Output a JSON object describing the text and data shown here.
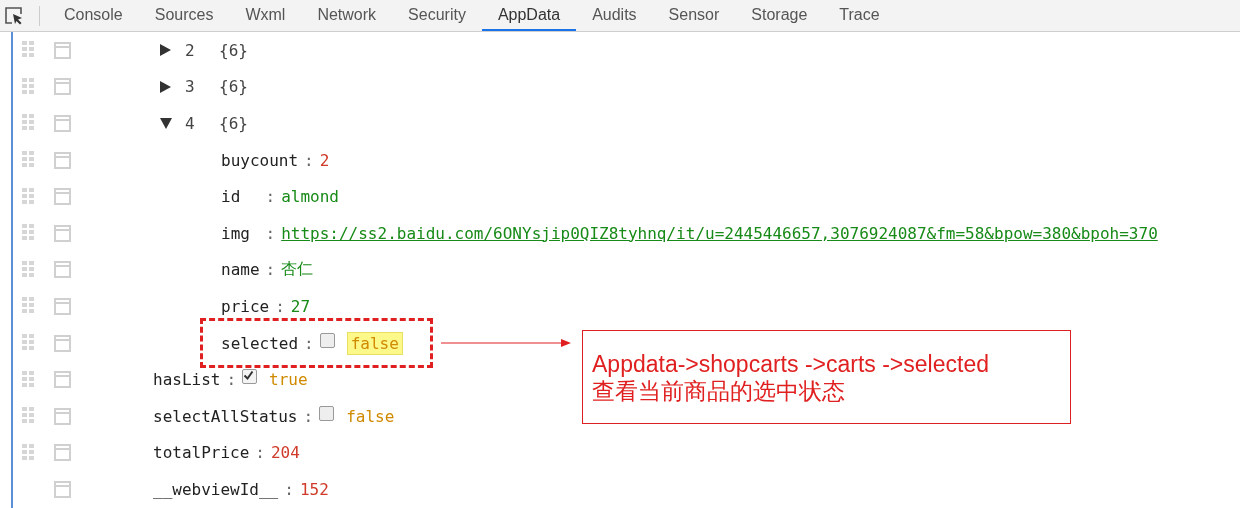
{
  "tabs": [
    {
      "label": "Console",
      "selected": false
    },
    {
      "label": "Sources",
      "selected": false
    },
    {
      "label": "Wxml",
      "selected": false
    },
    {
      "label": "Network",
      "selected": false
    },
    {
      "label": "Security",
      "selected": false
    },
    {
      "label": "AppData",
      "selected": true
    },
    {
      "label": "Audits",
      "selected": false
    },
    {
      "label": "Sensor",
      "selected": false
    },
    {
      "label": "Storage",
      "selected": false
    },
    {
      "label": "Trace",
      "selected": false
    }
  ],
  "tree": [
    {
      "kind": "group",
      "children": [
        {
          "kind": "node",
          "key": "2",
          "summary": "{6}",
          "expanded": false
        },
        {
          "kind": "node",
          "key": "3",
          "summary": "{6}",
          "expanded": false
        },
        {
          "kind": "node",
          "key": "4",
          "summary": "{6}",
          "expanded": true,
          "children": [
            {
              "kind": "number",
              "key": "buycount",
              "separator": ":",
              "value": "2"
            },
            {
              "kind": "string",
              "key": "id",
              "separator": ":",
              "value": "almond"
            },
            {
              "kind": "link",
              "key": "img",
              "separator": ":",
              "value": "https://ss2.baidu.com/6ONYsjip0QIZ8tyhnq/it/u=2445446657,3076924087&fm=58&bpow=380&bpoh=370"
            },
            {
              "kind": "string",
              "key": "name",
              "separator": ":",
              "value": "杏仁"
            },
            {
              "kind": "string",
              "key": "price",
              "separator": ":",
              "value": "27"
            },
            {
              "kind": "boolean",
              "key": "selected",
              "separator": ":",
              "value": "false",
              "checked": false,
              "highlighted": true
            }
          ]
        }
      ]
    },
    {
      "kind": "boolean",
      "key": "hasList",
      "separator": ":",
      "value": "true",
      "checked": true,
      "highlighted": false
    },
    {
      "kind": "boolean",
      "key": "selectAllStatus",
      "separator": ":",
      "value": "false",
      "checked": false,
      "highlighted": false
    },
    {
      "kind": "number",
      "key": "totalPrice",
      "separator": ":",
      "value": "204"
    },
    {
      "kind": "number",
      "key": "__webviewId__",
      "separator": ":",
      "value": "152",
      "draggable": false
    }
  ],
  "annotation": {
    "lines": [
      "Appdata->shopcarts ->carts ->selected",
      "查看当前商品的选中状态"
    ]
  }
}
